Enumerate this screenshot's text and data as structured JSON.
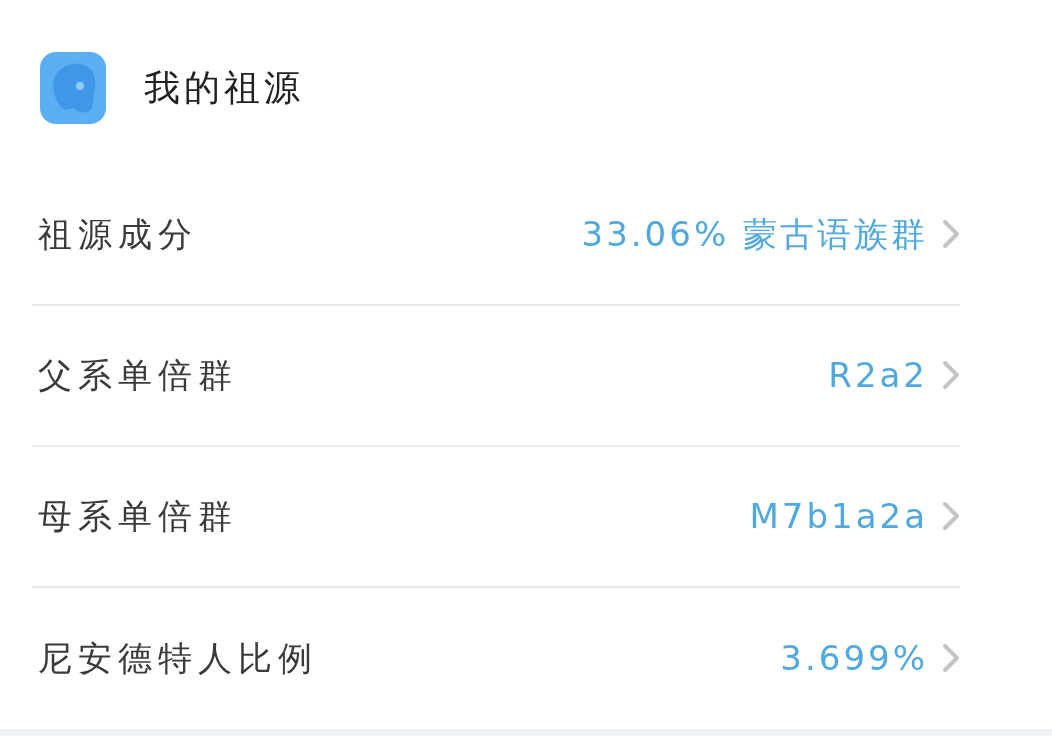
{
  "header": {
    "title": "我的祖源"
  },
  "rows": [
    {
      "label": "祖源成分",
      "value": "33.06% 蒙古语族群"
    },
    {
      "label": "父系单倍群",
      "value": "R2a2"
    },
    {
      "label": "母系单倍群",
      "value": "M7b1a2a"
    },
    {
      "label": "尼安德特人比例",
      "value": "3.699%"
    }
  ]
}
